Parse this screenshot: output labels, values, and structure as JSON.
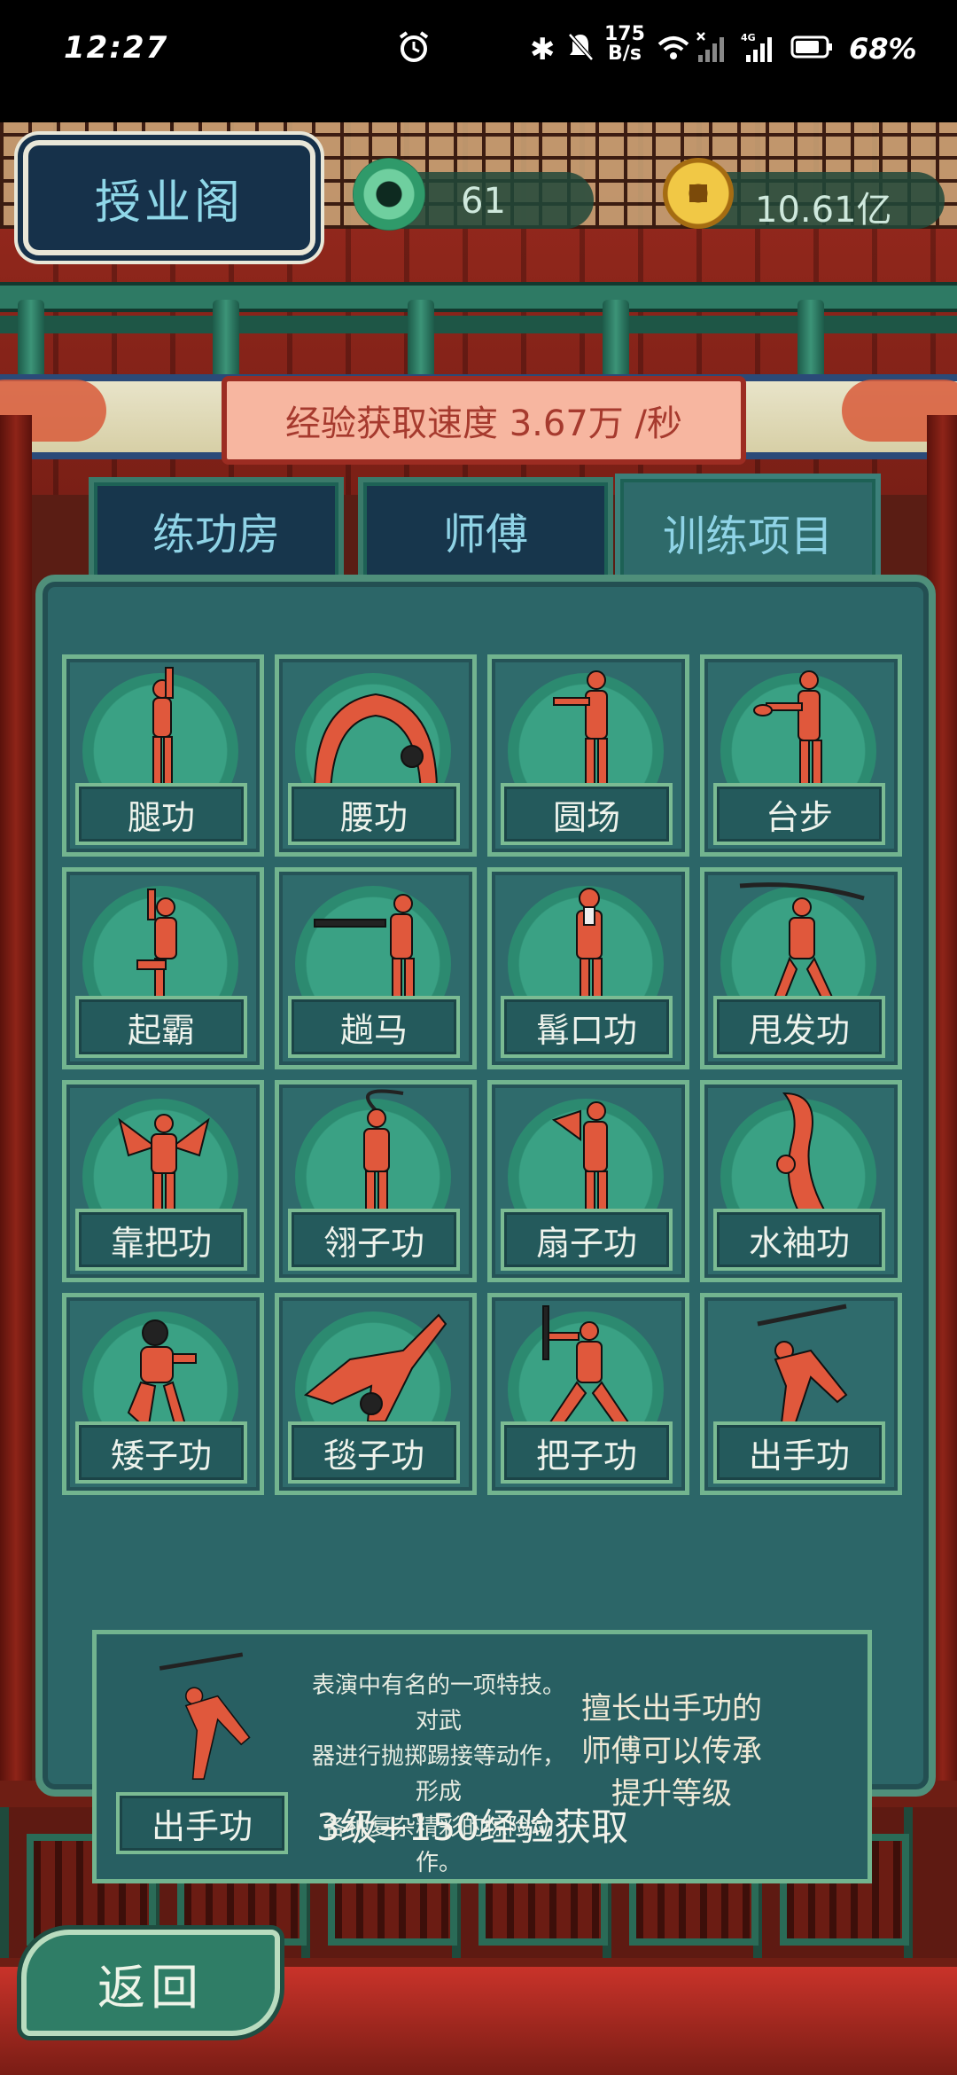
{
  "status_bar": {
    "time": "12:27",
    "net_speed_value": "175",
    "net_speed_unit": "B/s",
    "battery_percent": "68%",
    "icons": [
      "alarm-icon",
      "bluetooth-icon",
      "mute-icon",
      "wifi-icon",
      "signal-icon",
      "signal-4g-icon",
      "battery-icon"
    ]
  },
  "header": {
    "title": "授业阁",
    "jade_amount": "61",
    "coin_amount": "10.61亿"
  },
  "exp_speed": "经验获取速度 3.67万 /秒",
  "tabs": [
    {
      "label": "练功房",
      "active": false
    },
    {
      "label": "师傅",
      "active": false
    },
    {
      "label": "训练项目",
      "active": true
    }
  ],
  "skills": [
    {
      "label": "腿功"
    },
    {
      "label": "腰功"
    },
    {
      "label": "圆场"
    },
    {
      "label": "台步"
    },
    {
      "label": "起霸"
    },
    {
      "label": "趟马"
    },
    {
      "label": "髯口功"
    },
    {
      "label": "甩发功"
    },
    {
      "label": "靠把功"
    },
    {
      "label": "翎子功"
    },
    {
      "label": "扇子功"
    },
    {
      "label": "水袖功"
    },
    {
      "label": "矮子功"
    },
    {
      "label": "毯子功"
    },
    {
      "label": "把子功"
    },
    {
      "label": "出手功"
    }
  ],
  "selected_skill": {
    "label": "出手功",
    "description_lines": [
      "表演中有名的一项特技。对武",
      "器进行抛掷踢接等动作，形成",
      "各种复杂精彩的惊险动作。"
    ],
    "master_note_lines": [
      "擅长出手功的",
      "师傅可以传承",
      "提升等级"
    ],
    "exp_bonus": "3级+150经验获取"
  },
  "back_button": "返回",
  "colors": {
    "panel": "#2c6668",
    "card_border": "#72b48f",
    "figure": "#e0583c",
    "tab_text": "#8fd3e6",
    "exp_banner": "#f7b6a0"
  }
}
